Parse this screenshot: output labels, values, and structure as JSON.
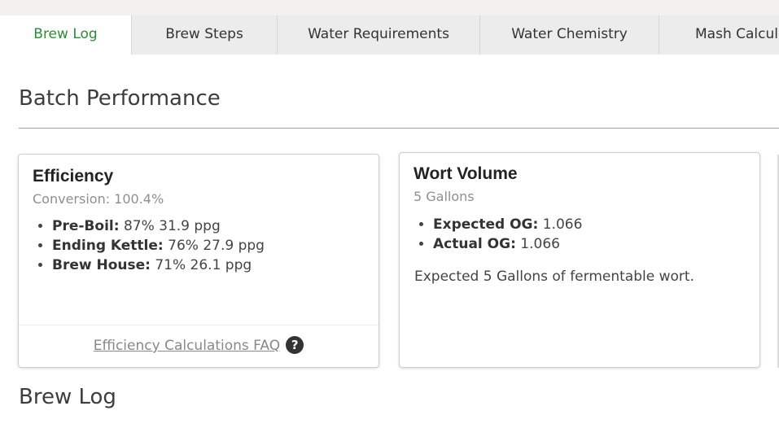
{
  "tabs": [
    {
      "label": "Brew Log",
      "active": true
    },
    {
      "label": "Brew Steps"
    },
    {
      "label": "Water Requirements"
    },
    {
      "label": "Water Chemistry"
    },
    {
      "label": "Mash Calcula"
    }
  ],
  "batch_performance": {
    "title": "Batch Performance",
    "efficiency": {
      "title": "Efficiency",
      "subtitle": "Conversion: 100.4%",
      "items": [
        {
          "label": "Pre-Boil:",
          "value": "87% 31.9 ppg"
        },
        {
          "label": "Ending Kettle:",
          "value": "76% 27.9 ppg"
        },
        {
          "label": "Brew House:",
          "value": "71% 26.1 ppg"
        }
      ],
      "faq_link": "Efficiency Calculations FAQ",
      "help_icon": "?"
    },
    "wort_volume": {
      "title": "Wort Volume",
      "subtitle": "5 Gallons",
      "items": [
        {
          "label": "Expected OG:",
          "value": "1.066"
        },
        {
          "label": "Actual OG:",
          "value": "1.066"
        }
      ],
      "note": "Expected 5 Gallons of fermentable wort."
    }
  },
  "brew_log": {
    "title": "Brew Log"
  },
  "colors": {
    "active_tab": "#2e8b3a",
    "tab_bg": "#ececec",
    "accent_text": "#333333"
  }
}
